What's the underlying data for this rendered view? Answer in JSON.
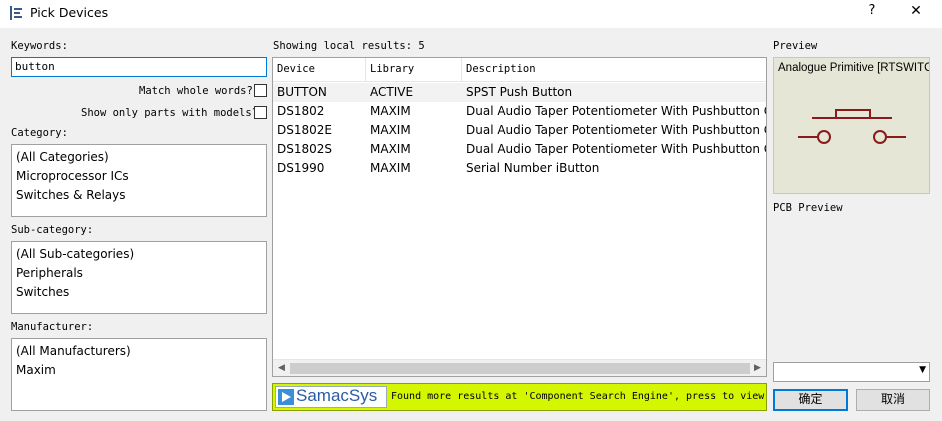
{
  "window": {
    "title": "Pick Devices",
    "help_label": "?",
    "close_label": "✕"
  },
  "keywords": {
    "label": "Keywords:",
    "value": "button"
  },
  "options": {
    "match_whole_words": "Match whole words?",
    "only_with_models": "Show only parts with models?"
  },
  "category": {
    "label": "Category:",
    "items": [
      "(All Categories)",
      "Microprocessor ICs",
      "Switches & Relays"
    ]
  },
  "subcategory": {
    "label": "Sub-category:",
    "items": [
      "(All Sub-categories)",
      "Peripherals",
      "Switches"
    ]
  },
  "manufacturer": {
    "label": "Manufacturer:",
    "items": [
      "(All Manufacturers)",
      "Maxim"
    ]
  },
  "results": {
    "summary": "Showing local results: 5",
    "columns": [
      "Device",
      "Library",
      "Description"
    ],
    "rows": [
      {
        "device": "BUTTON",
        "library": "ACTIVE",
        "description": "SPST Push Button"
      },
      {
        "device": "DS1802",
        "library": "MAXIM",
        "description": "Dual Audio Taper Potentiometer With Pushbutton Control"
      },
      {
        "device": "DS1802E",
        "library": "MAXIM",
        "description": "Dual Audio Taper Potentiometer With Pushbutton Control"
      },
      {
        "device": "DS1802S",
        "library": "MAXIM",
        "description": "Dual Audio Taper Potentiometer With Pushbutton Control"
      },
      {
        "device": "DS1990",
        "library": "MAXIM",
        "description": "Serial Number iButton"
      }
    ]
  },
  "banner": {
    "logo_text": "SamacSys",
    "message": "Found more results at 'Component Search Engine', press to view"
  },
  "preview": {
    "label": "Preview",
    "caption": "Analogue Primitive [RTSWITCH]",
    "pcb_label": "PCB Preview",
    "symbol_color": "#8b1a1a",
    "background_color": "#e6e6d6"
  },
  "buttons": {
    "ok": "确定",
    "cancel": "取消"
  }
}
